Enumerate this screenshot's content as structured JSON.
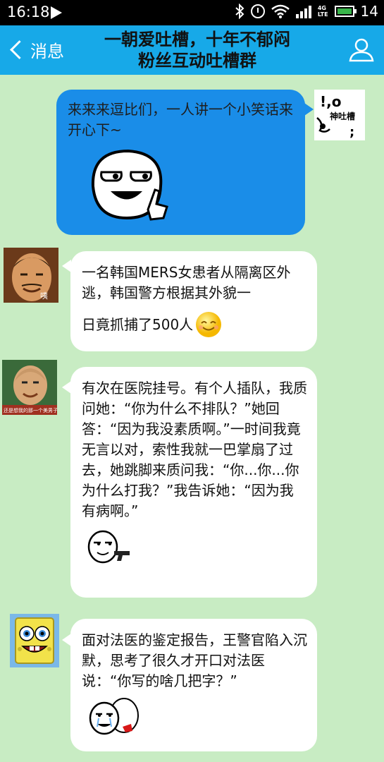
{
  "status_bar": {
    "time": "16:18",
    "network": "4G LTE",
    "battery": "14"
  },
  "header": {
    "back_label": "消息",
    "title_line1": "一朝爱吐槽，十年不郁闷",
    "title_line2": "粉丝互动吐槽群"
  },
  "messages": [
    {
      "side": "right",
      "sender_avatar": "吐槽 logo avatar",
      "avatar_text": "!,o\n神吐槽",
      "text": "来来来逗比们，一人讲一个小笑话来开心下~",
      "sticker": "smirking-face-sticker"
    },
    {
      "side": "left",
      "avatar_caption": "咦",
      "text_line1": "一名韩国MERS女患者从隔离区外逃，韩国警方根据其外貌一",
      "text_line2": "日竟抓捕了500人",
      "emoji": "smile-emoji"
    },
    {
      "side": "left",
      "avatar_caption": "还是想我的那一个美男子",
      "text": "有次在医院挂号。有个人插队，我质问她：“你为什么不排队？”她回答：“因为我没素质啊。”一时间我竟无言以对，索性我就一巴掌扇了过去，她跳脚来质问我：“你...你...你为什么打我？”我告诉她：“因为我有病啊。”",
      "sticker": "gun-face-sticker"
    },
    {
      "side": "left",
      "text": "面对法医的鉴定报告，王警官陷入沉默，思考了很久才开口对法医说：“你写的啥几把字？”",
      "sticker": "crying-duo-sticker"
    }
  ],
  "colors": {
    "background": "#c8ecc3",
    "header": "#17a9e8",
    "right_bubble": "#1a8de8",
    "left_bubble": "#ffffff"
  }
}
